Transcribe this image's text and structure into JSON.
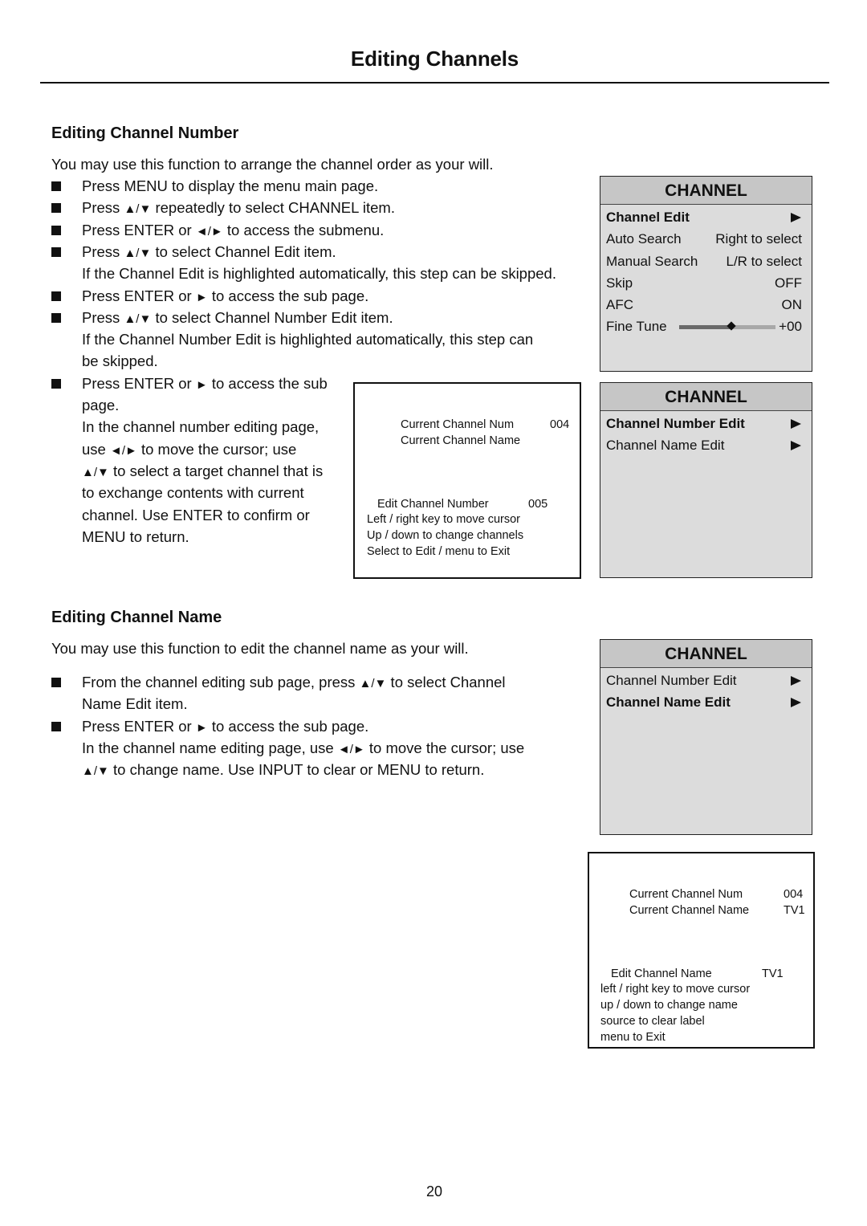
{
  "page": {
    "title": "Editing Channels",
    "page_number": "20"
  },
  "symbols": {
    "up_down": "▲/▼",
    "left_right": "◄/►",
    "right": "►"
  },
  "number_section": {
    "heading": "Editing Channel Number",
    "intro": "You may use this function to arrange the channel order as your will.",
    "lines": [
      {
        "bullet": true,
        "text": "Press MENU to display the menu main page."
      },
      {
        "bullet": true,
        "pre": "Press ",
        "sym": "▲/▼",
        "post": " repeatedly to select CHANNEL item."
      },
      {
        "bullet": true,
        "pre": "Press ENTER or ",
        "sym": "◄/►",
        "post": " to access the submenu."
      },
      {
        "bullet": true,
        "pre": "Press ",
        "sym": "▲/▼",
        "post": " to select Channel Edit item."
      },
      {
        "bullet": false,
        "text": "If the Channel Edit is highlighted automatically, this step can be skipped."
      },
      {
        "bullet": true,
        "pre": "Press ENTER or ",
        "sym": "►",
        "post": " to access the sub page."
      },
      {
        "bullet": true,
        "pre": "Press ",
        "sym": "▲/▼",
        "post": " to select Channel Number Edit item."
      },
      {
        "bullet": false,
        "text": "If the Channel Number Edit is highlighted automatically, this step can"
      },
      {
        "bullet": false,
        "text": "be skipped."
      },
      {
        "bullet": true,
        "pre": "Press ENTER or ",
        "sym": "►",
        "post": " to access the sub"
      },
      {
        "bullet": false,
        "text": "page."
      },
      {
        "bullet": false,
        "text": "In the channel number editing page,"
      },
      {
        "bullet": false,
        "pre": "use ",
        "sym": "◄/►",
        "post": "  to move the cursor; use"
      },
      {
        "bullet": false,
        "pre": "",
        "sym": "▲/▼",
        "post": " to select a target channel that is"
      },
      {
        "bullet": false,
        "text": "to exchange contents with current"
      },
      {
        "bullet": false,
        "text": "channel. Use ENTER to confirm or"
      },
      {
        "bullet": false,
        "text": "MENU to return."
      }
    ]
  },
  "name_section": {
    "heading": "Editing Channel Name",
    "intro": "You may use this function to edit the channel name as your will.",
    "lines": [
      {
        "bullet": true,
        "pre": "From the channel editing sub page, press ",
        "sym": "▲/▼",
        "post": " to select Channel"
      },
      {
        "bullet": false,
        "text": "Name Edit item."
      },
      {
        "bullet": true,
        "pre": "Press ENTER or ",
        "sym": "►",
        "post": " to access the sub page."
      },
      {
        "bullet": false,
        "pre": "In the channel name editing page, use ",
        "sym": "◄/►",
        "post": "  to move the cursor; use"
      },
      {
        "bullet": false,
        "pre": "",
        "sym": "▲/▼",
        "post": " to change name. Use INPUT to clear or MENU to return."
      }
    ]
  },
  "menu_channel_main": {
    "title": "CHANNEL",
    "rows": [
      {
        "label": "Channel Edit",
        "value": "",
        "arrow": true,
        "selected": true
      },
      {
        "label": "Auto Search",
        "value": "Right to select"
      },
      {
        "label": "Manual Search",
        "value": "L/R to select"
      },
      {
        "label": "Skip",
        "value": "OFF"
      },
      {
        "label": "AFC",
        "value": "ON"
      },
      {
        "label": "Fine Tune",
        "value": "+00",
        "slider_percent": 54
      }
    ]
  },
  "menu_channel_edit_number": {
    "title": "CHANNEL",
    "rows": [
      {
        "label": "Channel Number Edit",
        "arrow": true,
        "selected": true
      },
      {
        "label": "Channel Name Edit",
        "arrow": true,
        "selected": false
      }
    ]
  },
  "menu_channel_edit_name": {
    "title": "CHANNEL",
    "rows": [
      {
        "label": "Channel Number Edit",
        "arrow": true,
        "selected": false
      },
      {
        "label": "Channel Name Edit",
        "arrow": true,
        "selected": true
      }
    ]
  },
  "dialog_number": {
    "current_num_label": "Current Channel Num",
    "current_num_value": "004",
    "current_name_label": "Current Channel Name",
    "current_name_value": "",
    "edit_label": "Edit Channel Number",
    "edit_value": "005",
    "help": [
      "Left / right key to move cursor",
      "Up / down to change channels",
      "Select to Edit / menu to Exit"
    ]
  },
  "dialog_name": {
    "current_num_label": "Current Channel Num",
    "current_num_value": "004",
    "current_name_label": "Current Channel Name",
    "current_name_value": "TV1",
    "edit_label": "Edit Channel Name",
    "edit_value": "TV1",
    "help": [
      "left / right key to move cursor",
      "up / down to change name",
      "source to clear label",
      "menu to Exit"
    ]
  }
}
